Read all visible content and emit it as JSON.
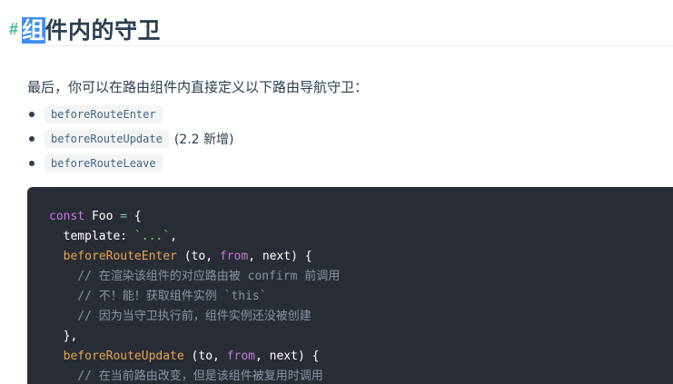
{
  "section": {
    "hash": "#",
    "title_selected": "组",
    "title_rest": "件内的守卫"
  },
  "intro": "最后，你可以在路由组件内直接定义以下路由导航守卫：",
  "hooks": [
    {
      "name": "beforeRouteEnter",
      "note": ""
    },
    {
      "name": "beforeRouteUpdate",
      "note": "(2.2 新增)"
    },
    {
      "name": "beforeRouteLeave",
      "note": ""
    }
  ],
  "code": {
    "lines": [
      [
        {
          "t": "const",
          "c": "kw"
        },
        {
          "t": " Foo ",
          "c": "pl"
        },
        {
          "t": "=",
          "c": "op"
        },
        {
          "t": " {",
          "c": "pl"
        }
      ],
      [
        {
          "t": "  template: ",
          "c": "pl"
        },
        {
          "t": "`...`",
          "c": "str"
        },
        {
          "t": ",",
          "c": "pl"
        }
      ],
      [
        {
          "t": "  ",
          "c": "pl"
        },
        {
          "t": "beforeRouteEnter",
          "c": "fn"
        },
        {
          "t": " (to, ",
          "c": "pl"
        },
        {
          "t": "from",
          "c": "kw"
        },
        {
          "t": ", next) {",
          "c": "pl"
        }
      ],
      [
        {
          "t": "    // 在渲染该组件的对应路由被 confirm 前调用",
          "c": "cm"
        }
      ],
      [
        {
          "t": "    // 不！能！获取组件实例 `this`",
          "c": "cm"
        }
      ],
      [
        {
          "t": "    // 因为当守卫执行前，组件实例还没被创建",
          "c": "cm"
        }
      ],
      [
        {
          "t": "  },",
          "c": "pl"
        }
      ],
      [
        {
          "t": "  ",
          "c": "pl"
        },
        {
          "t": "beforeRouteUpdate",
          "c": "fn"
        },
        {
          "t": " (to, ",
          "c": "pl"
        },
        {
          "t": "from",
          "c": "kw"
        },
        {
          "t": ", next) {",
          "c": "pl"
        }
      ],
      [
        {
          "t": "    // 在当前路由改变，但是该组件被复用时调用",
          "c": "cm"
        }
      ]
    ]
  }
}
